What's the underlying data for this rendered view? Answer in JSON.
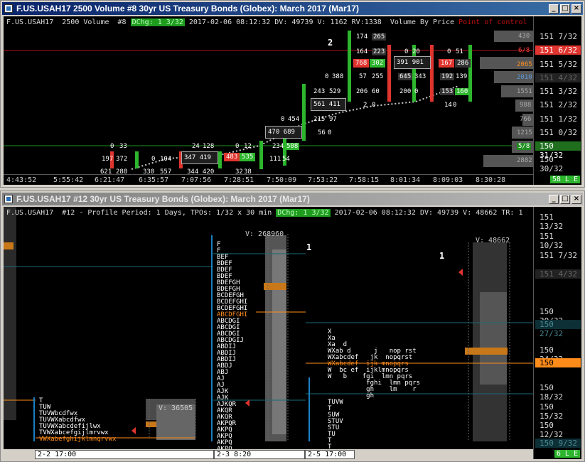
{
  "win1": {
    "title": "F.US.USAH17  2500 Volume  #8  30yr US Treasury Bonds (Globex): March 2017 (Mar17)",
    "header_pre": "F.US.USAH17  2500 Volume  #8 ",
    "header_tag": "DChg: 1 3/32",
    "header_post": " 2017-02-06 08:12:32 DV: 49739 V: 1162 RV:1338  Volume By Price ",
    "header_red": "Point of control",
    "prices": [
      "151 7/32",
      "151 6/32",
      "151 5/32",
      "151 4/32",
      "151 3/32",
      "151 2/32",
      "151 1/32",
      "151 0/32",
      "150 31/32",
      "150 30/32"
    ],
    "vbp_numbers": [
      "430",
      "6/8",
      "2065",
      "2010",
      "1551",
      "988",
      "766",
      "1215",
      "5/8",
      "2882"
    ],
    "times": [
      "4:43:52",
      "5:55:42",
      "6:21:47",
      "6:35:57",
      "7:07:56",
      "7:28:51",
      "7:50:09",
      "7:53:22",
      "7:58:15",
      "8:01:34",
      "8:09:03",
      "8:30:28"
    ],
    "marker": "2",
    "live": "58 L E",
    "cells": [
      "174",
      "265",
      "164",
      "223",
      "768",
      "302",
      "0",
      "20",
      "391",
      "901",
      "0",
      "51",
      "167",
      "286",
      "0",
      "388",
      "57",
      "255",
      "645",
      "343",
      "192",
      "139",
      "243",
      "529",
      "206",
      "60",
      "200",
      "0",
      "153",
      "160",
      "561",
      "411",
      "2",
      "0",
      "14",
      "0",
      "0",
      "454",
      "215",
      "97",
      "470",
      "689",
      "56",
      "0",
      "0",
      "33",
      "24",
      "128",
      "0",
      "12",
      "234",
      "508",
      "197",
      "372",
      "0",
      "104",
      "347",
      "419",
      "483",
      "535",
      "111",
      "54",
      "621",
      "288",
      "330",
      "557",
      "344",
      "420",
      "32",
      "38"
    ]
  },
  "win2": {
    "title": "F.US.USAH17  #12  30yr US Treasury Bonds (Globex): March 2017 (Mar17)",
    "header_pre": "F.US.USAH17  #12 - Profile Period: 1 Days, TPOs: 1/32 x 30 min ",
    "header_tag": "DChg: 1 3/32",
    "header_post": " 2017-02-06 08:12:32 DV: 49739 V: 48662 TR: 1",
    "prices": [
      "151 13/32",
      "151 10/32",
      "151 7/32",
      "151 4/32",
      "150 30/32",
      "150 27/32",
      "150 24/32",
      "150 22/32",
      "150 18/32",
      "150 15/32",
      "150 12/32",
      "150 9/32"
    ],
    "vol1": "V: 36505",
    "vol2": "V: 268960",
    "vol3": "V: 48662",
    "mark1": "1",
    "mark2": "1",
    "dates": [
      "2-2  17:00",
      "2-3  8:20",
      "2-5  17:00"
    ],
    "live": "6 L E",
    "tpo1": [
      "T",
      "TUW",
      "TUVWbcdfwx",
      "TUVWXabcdfwx",
      "TUVWXabcdefijlwx",
      "TVWXabcefgijlmrvwx",
      "VWXabefghijklmnqrvwx"
    ],
    "tpo2": [
      "F",
      "F",
      "BEF",
      "BDEF",
      "BDEF",
      "BDEF",
      "BDEFGH",
      "BDEFGH",
      "BCDEFGH",
      "BCDEFGHI",
      "BCDEFGHI",
      "ABCDFGHI",
      "ABCDGI",
      "ABCDGI",
      "ABCDGI",
      "ABCDGIJ",
      "ABDIJ",
      "ABDIJ",
      "ABDIJ",
      "ABDJ",
      "ABJ",
      "AJ",
      "AJ",
      "AJK",
      "AJK",
      "AJKQR",
      "AKQR",
      "AKQR",
      "AKPQR",
      "AKPQ",
      "AKPQ",
      "AKPQ",
      "AKPQ"
    ],
    "tpo3": [
      "X",
      "Xa",
      "Xa  d",
      "WXab d      j   nop rst",
      "WXabcdef   jk  nopqrst",
      "WXabcdef  ijk mnopqrs",
      "W  bc ef  ijklmnopqrs",
      "W   b    fgi  lmn pqrs",
      "          fghi  lmn pqrs",
      "          gh    lm    r",
      "          gh",
      "TUVW",
      "T",
      "SUW",
      "STUV",
      "STU",
      "TU",
      "T",
      "T"
    ]
  },
  "colors": {
    "green": "#2db52d",
    "red": "#e0342f",
    "orange": "#ff8c1a",
    "cyan": "#1aa0c8"
  }
}
